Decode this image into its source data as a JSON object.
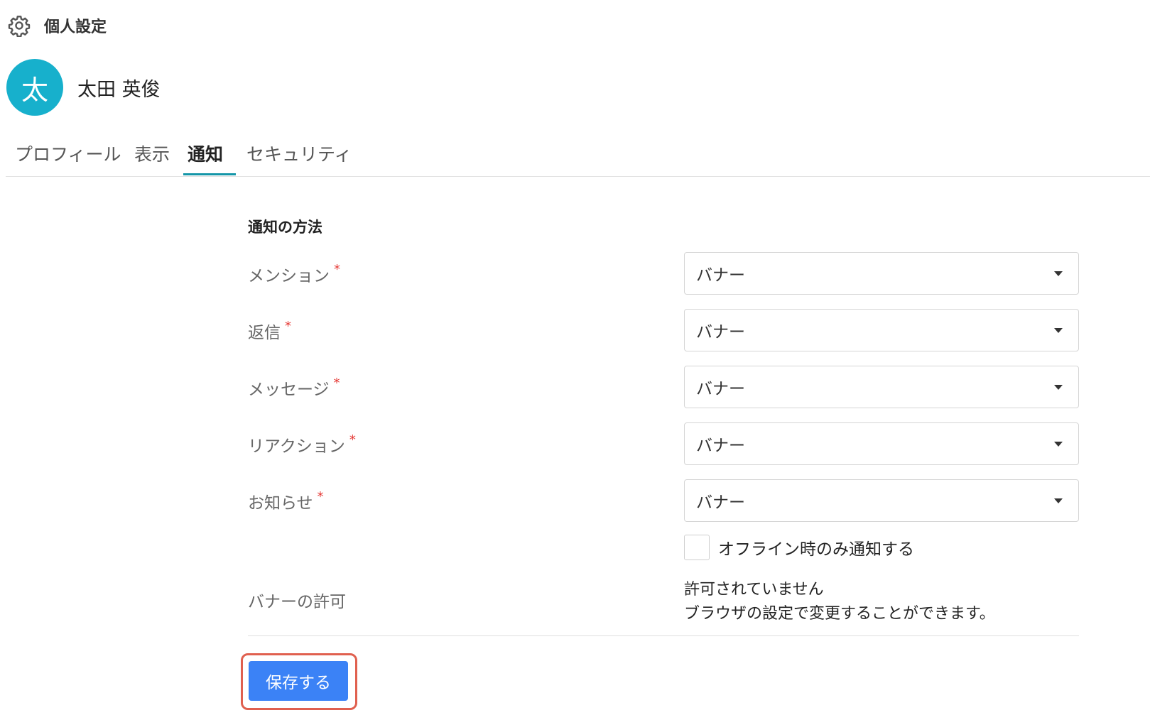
{
  "header": {
    "title": "個人設定",
    "icon": "gear-icon"
  },
  "user": {
    "avatar_initial": "太",
    "avatar_color": "#17b0cc",
    "name": "太田 英俊"
  },
  "tabs": [
    {
      "label": "プロフィール",
      "active": false
    },
    {
      "label": "表示",
      "active": false
    },
    {
      "label": "通知",
      "active": true
    },
    {
      "label": "セキュリティ",
      "active": false
    }
  ],
  "section": {
    "title": "通知の方法"
  },
  "fields": [
    {
      "label": "メンション",
      "required_mark": "*",
      "value": "バナー"
    },
    {
      "label": "返信",
      "required_mark": "*",
      "value": "バナー"
    },
    {
      "label": "メッセージ",
      "required_mark": "*",
      "value": "バナー"
    },
    {
      "label": "リアクション",
      "required_mark": "*",
      "value": "バナー"
    },
    {
      "label": "お知らせ",
      "required_mark": "*",
      "value": "バナー"
    }
  ],
  "offline_only": {
    "label": "オフライン時のみ通知する",
    "checked": false
  },
  "banner_permission": {
    "label": "バナーの許可",
    "status": "許可されていません",
    "hint": "ブラウザの設定で変更することができます。"
  },
  "actions": {
    "save_label": "保存する"
  },
  "colors": {
    "accent": "#1496a8",
    "primary_button": "#3b82f6",
    "required": "#e53935",
    "highlight": "#e0604f"
  }
}
